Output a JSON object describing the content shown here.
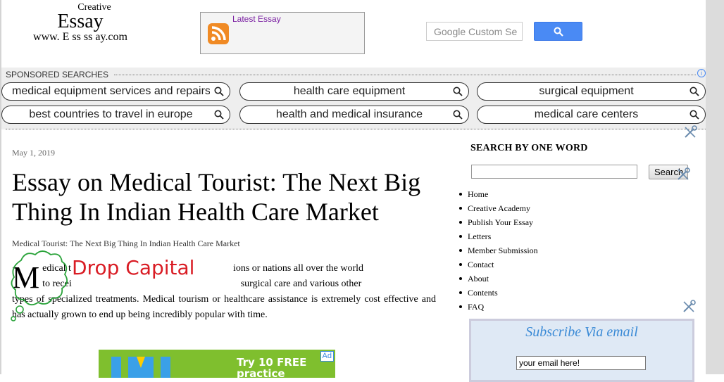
{
  "header": {
    "logo": {
      "line1": "Creative",
      "line2": "Essay",
      "line3": "www. E ss ss ay.com"
    },
    "rss": {
      "title": "Latest Essay",
      "icon": "rss-icon"
    },
    "search": {
      "placeholder": "Google Custom Se",
      "button_icon": "search-icon"
    }
  },
  "sponsored": {
    "label": "SPONSORED SEARCHES",
    "info_icon": "i",
    "items": [
      "medical equipment services and repairs",
      "health care equipment",
      "surgical equipment",
      "best countries to travel in europe",
      "health and medical insurance",
      "medical care centers"
    ]
  },
  "article": {
    "date": "May 1, 2019",
    "title": "Essay on Medical Tourist: The Next Big Thing In Indian Health Care Market",
    "subtitle": "Medical Tourist: The Next Big Thing In Indian Health Care Market",
    "dropcap": "M",
    "dropcap_annotation": "Drop Capital",
    "body_line1_start": "edical t",
    "body_line1_end": "ions or nations all over the world",
    "body_line2_start": "to recei",
    "body_line2_end": "surgical care and various other",
    "body_rest": "types of specialized treatments. Medical tourism or healthcare assistance is extremely cost effective and has actually grown to end up being incredibly popular with time.",
    "ad": {
      "text_line1": "Try 10 FREE",
      "text_line2": "practice problems!",
      "tag": "Ad"
    }
  },
  "sidebar": {
    "search_title": "SEARCH BY ONE WORD",
    "search_button": "Search",
    "nav": [
      "Home",
      "Creative Academy",
      "Publish Your Essay",
      "Letters",
      "Member Submission",
      "Contact",
      "About",
      "Contents",
      "FAQ"
    ],
    "subscribe": {
      "title": "Subscribe Via email",
      "email_value": "your email here!"
    }
  },
  "colors": {
    "accent_blue": "#4a8af4",
    "rss_orange": "#f08a24",
    "annotation_red": "#d91c24",
    "annotation_green": "#2aa33a",
    "subscribe_title": "#3a8ad6"
  }
}
